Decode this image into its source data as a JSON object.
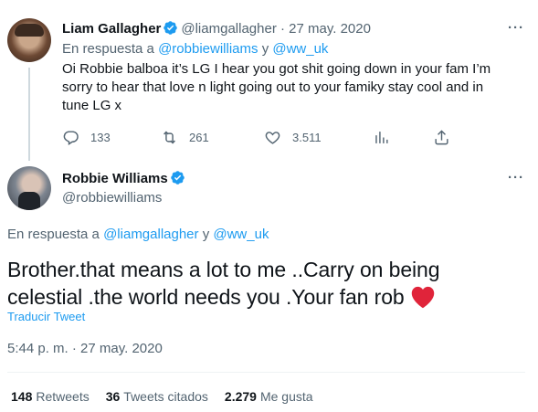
{
  "reply": {
    "name": "Liam Gallagher",
    "handle": "@liamgallagher",
    "separator": "·",
    "date": "27 may. 2020",
    "in_reply_prefix": "En respuesta a",
    "reply_to_1": "@robbiewilliams",
    "conj": "y",
    "reply_to_2": "@ww_uk",
    "text": "Oi Robbie balboa it’s LG I hear you got shit going down in your fam I’m sorry to hear that love n light going out to your famiky stay cool and in tune LG x",
    "actions": {
      "replies": "133",
      "retweets": "261",
      "likes": "3.511"
    }
  },
  "tweet": {
    "name": "Robbie Williams",
    "handle": "@robbiewilliams",
    "in_reply_prefix": "En respuesta a",
    "reply_to_1": "@liamgallagher",
    "conj": "y",
    "reply_to_2": "@ww_uk",
    "text": "Brother.that means a lot to me ..Carry on being celestial .the world needs you .Your fan rob",
    "translate": "Traducir Tweet",
    "timestamp": "5:44 p. m. · 27 may. 2020",
    "stats": {
      "retweets_count": "148",
      "retweets_label": "Retweets",
      "quotes_count": "36",
      "quotes_label": "Tweets citados",
      "likes_count": "2.279",
      "likes_label": "Me gusta"
    }
  },
  "colors": {
    "accent": "#1d9bf0",
    "muted": "#536471",
    "heart": "#f4212e"
  }
}
